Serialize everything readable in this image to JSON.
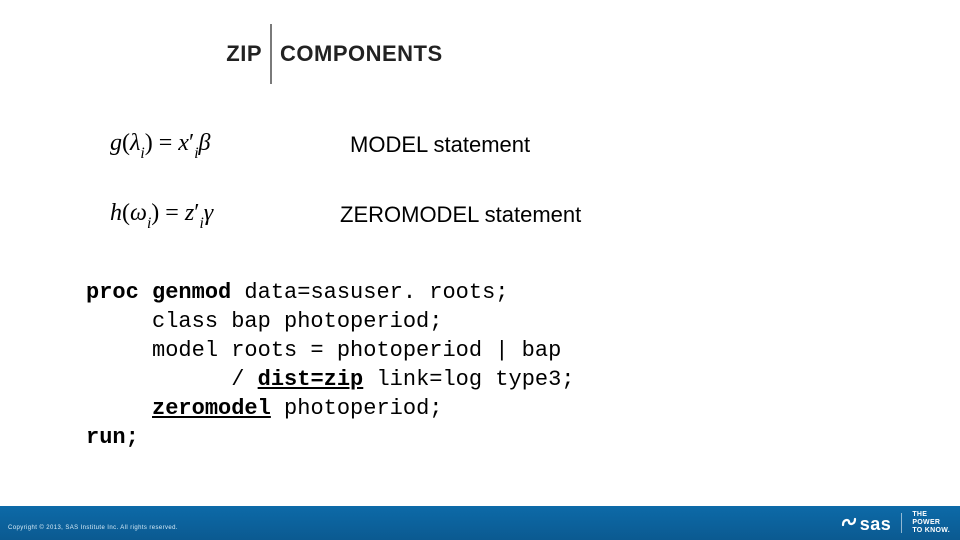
{
  "title": {
    "left": "ZIP",
    "right": "COMPONENTS"
  },
  "equations": [
    {
      "label": "MODEL statement"
    },
    {
      "label": "ZEROMODEL statement"
    }
  ],
  "code": {
    "l1_kw": "proc genmod",
    "l1_rest": " data=sasuser. roots;",
    "l2": "     class bap photoperiod;",
    "l3": "     model roots = photoperiod | bap",
    "l4_a": "           / ",
    "l4_b": "dist=zip",
    "l4_c": " link=log type3;",
    "l5_a": "     ",
    "l5_b": "zeromodel",
    "l5_c": " photoperiod;",
    "l6": "run;"
  },
  "footer": {
    "copyright": "Copyright © 2013, SAS Institute Inc. All rights reserved.",
    "logo_text": "sas",
    "tag1": "THE",
    "tag2": "POWER",
    "tag3": "TO KNOW"
  }
}
